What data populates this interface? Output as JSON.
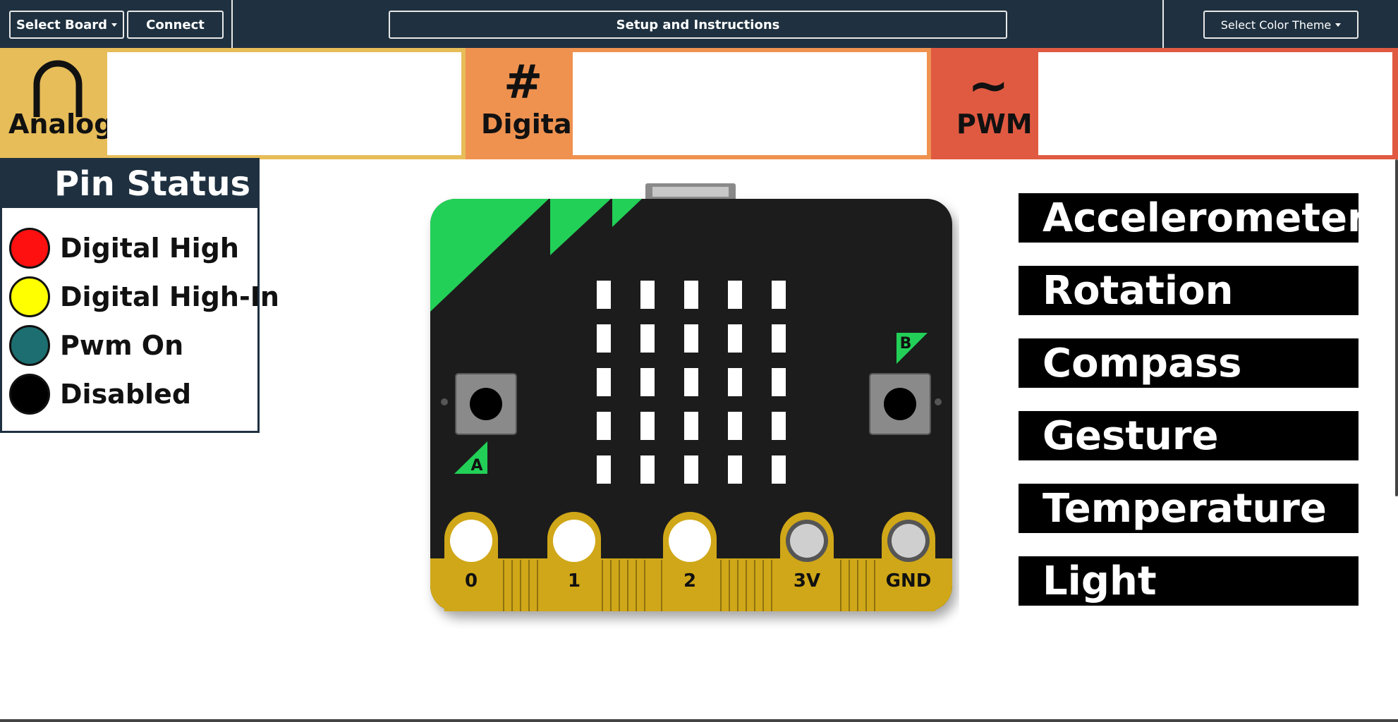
{
  "navbar": {
    "select_board": "Select Board",
    "connect": "Connect",
    "setup": "Setup and Instructions",
    "color_theme": "Select Color Theme"
  },
  "modes": [
    {
      "label": "Analog",
      "symbol": "∩",
      "color": "#e7bd59"
    },
    {
      "label": "Digital",
      "symbol": "#",
      "color": "#ef9250"
    },
    {
      "label": "PWM",
      "symbol": "~",
      "color": "#e05a41"
    }
  ],
  "pin_status": {
    "title": "Pin Status",
    "items": [
      {
        "label": "Digital High",
        "color": "#ff1010"
      },
      {
        "label": "Digital High-In",
        "color": "#ffff00"
      },
      {
        "label": "Pwm On",
        "color": "#1c6e70"
      },
      {
        "label": "Disabled",
        "color": "#000000"
      }
    ]
  },
  "board": {
    "button_a": "A",
    "button_b": "B",
    "pins": [
      "0",
      "1",
      "2",
      "3V",
      "GND"
    ],
    "pcb_color": "#1c1c1c",
    "accent_green": "#22d057",
    "gold": "#d0a718"
  },
  "sensors": [
    "Accelerometer",
    "Rotation",
    "Compass",
    "Gesture",
    "Temperature",
    "Light"
  ]
}
